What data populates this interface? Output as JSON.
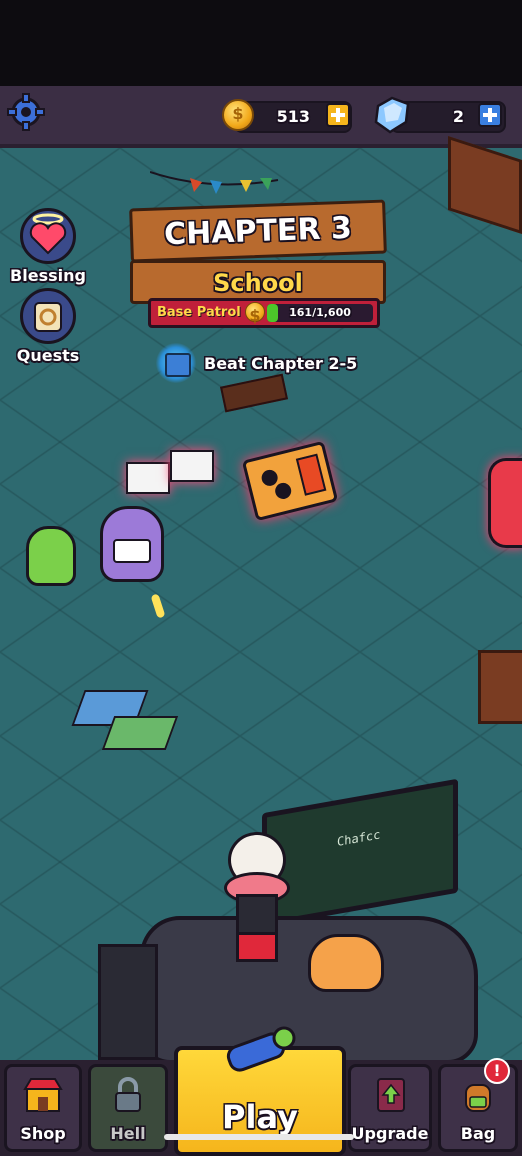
{
  "header": {
    "coins": "513",
    "gems": "2"
  },
  "side_menu": {
    "blessing_label": "Blessing",
    "quests_label": "Quests"
  },
  "chapter": {
    "title": "CHAPTER 3",
    "subtitle": "School",
    "patrol_label": "Base Patrol",
    "patrol_value": "161/1,600",
    "patrol_progress": 0.1
  },
  "objective": {
    "text": "Beat Chapter 2-5"
  },
  "nav": {
    "shop_label": "Shop",
    "hell_label": "Hell",
    "play_label": "Play",
    "upgrade_label": "Upgrade",
    "bag_label": "Bag",
    "bag_badge": "!"
  },
  "board": {
    "text": "Chafcc"
  },
  "colors": {
    "accent_gold": "#f5b51c",
    "gem_blue": "#3a7fe0",
    "patrol_red": "#c0203a",
    "progress_green": "#4cc72a",
    "floor_teal": "#2e6a70"
  },
  "icons": {
    "settings": "gear-icon",
    "coin": "coin-icon",
    "gem": "gem-icon",
    "chest": "chest-icon",
    "blessing": "heart-halo-icon",
    "quests": "scroll-icon",
    "shop": "shop-icon",
    "hell": "lock-icon",
    "play": "blaster-icon",
    "upgrade": "upgrade-book-icon",
    "bag": "backpack-icon"
  }
}
